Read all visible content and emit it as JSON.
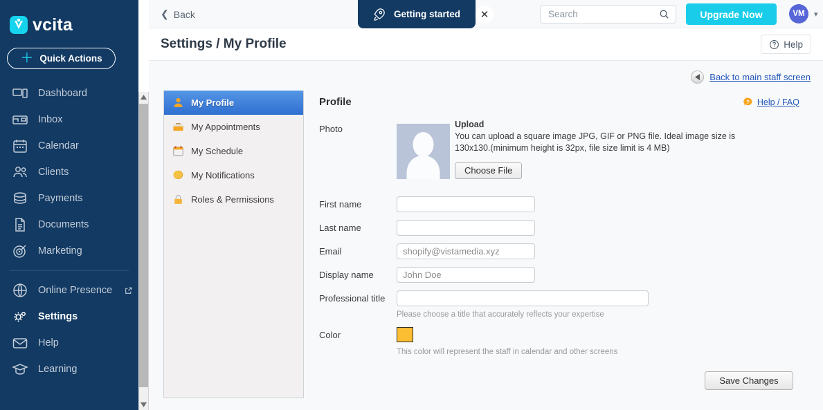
{
  "brand": {
    "name": "vcita",
    "logo_icon": "vcita-logo-icon",
    "accent": "#16d3ee"
  },
  "sidebar": {
    "quick_actions": {
      "label": "Quick Actions",
      "icon": "plus-icon"
    },
    "items": [
      {
        "label": "Dashboard",
        "icon": "dashboard-icon"
      },
      {
        "label": "Inbox",
        "icon": "inbox-icon"
      },
      {
        "label": "Calendar",
        "icon": "calendar-icon"
      },
      {
        "label": "Clients",
        "icon": "clients-icon"
      },
      {
        "label": "Payments",
        "icon": "payments-icon"
      },
      {
        "label": "Documents",
        "icon": "documents-icon"
      },
      {
        "label": "Marketing",
        "icon": "marketing-icon"
      }
    ],
    "items_secondary": [
      {
        "label": "Online Presence",
        "icon": "globe-icon",
        "external": true
      },
      {
        "label": "Settings",
        "icon": "gear-icon",
        "active": true
      },
      {
        "label": "Help",
        "icon": "envelope-icon"
      },
      {
        "label": "Learning",
        "icon": "graduation-cap-icon"
      }
    ]
  },
  "topbar": {
    "back_label": "Back",
    "back_icon": "chevron-left-icon",
    "getting_started": {
      "label": "Getting started",
      "icon": "rocket-icon"
    },
    "close_icon": "close-icon",
    "search": {
      "placeholder": "Search",
      "value": "",
      "icon": "search-icon"
    },
    "upgrade_label": "Upgrade Now",
    "upgrade_color": "#19cdea",
    "avatar": {
      "initials": "VM",
      "color": "#5766d6"
    },
    "caret_icon": "chevron-down-icon"
  },
  "titlebar": {
    "title": "Settings / My Profile",
    "help": {
      "label": "Help",
      "icon": "question-circle-icon"
    }
  },
  "content": {
    "back_to_staff": {
      "label": "Back to main staff screen",
      "icon": "back-arrow-icon"
    },
    "settings_menu": [
      {
        "label": "My Profile",
        "icon": "user-icon",
        "active": true
      },
      {
        "label": "My Appointments",
        "icon": "briefcase-icon",
        "active": false
      },
      {
        "label": "My Schedule",
        "icon": "calendar-icon",
        "active": false
      },
      {
        "label": "My Notifications",
        "icon": "notification-bubble-icon",
        "active": false
      },
      {
        "label": "Roles & Permissions",
        "icon": "lock-icon",
        "active": false
      }
    ],
    "profile": {
      "heading": "Profile",
      "help_faq": {
        "label": "Help / FAQ",
        "icon": "help-bubble-icon"
      },
      "photo": {
        "label": "Photo",
        "upload_title": "Upload",
        "upload_desc": "You can upload a square image JPG, GIF or PNG file. Ideal image size is 130x130.(minimum height is 32px, file size limit is 4 MB)",
        "choose_file_label": "Choose File",
        "placeholder_icon": "avatar-silhouette-icon"
      },
      "fields": [
        {
          "label": "First name",
          "value": "",
          "placeholder": ""
        },
        {
          "label": "Last name",
          "value": "",
          "placeholder": ""
        },
        {
          "label": "Email",
          "value": "",
          "placeholder": "shopify@vistamedia.xyz"
        },
        {
          "label": "Display name",
          "value": "",
          "placeholder": "John Doe"
        }
      ],
      "professional_title": {
        "label": "Professional title",
        "value": "",
        "hint": "Please choose a title that accurately reflects your expertise"
      },
      "color": {
        "label": "Color",
        "value": "#fbbd32",
        "hint": "This color will represent the staff in calendar and other screens"
      },
      "save_label": "Save Changes"
    }
  }
}
